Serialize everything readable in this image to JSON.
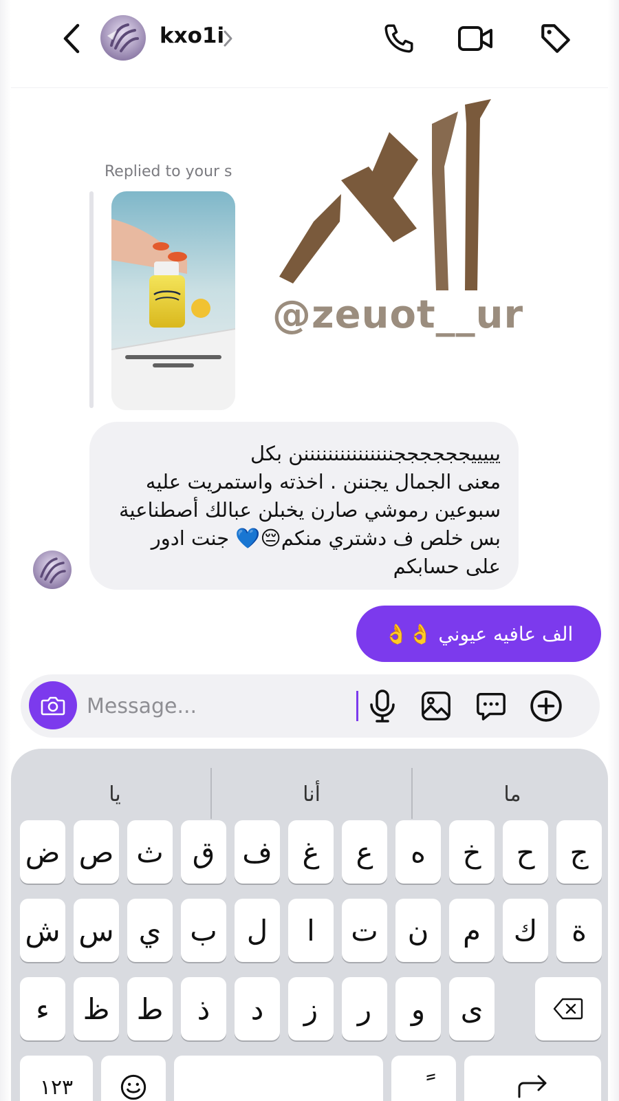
{
  "header": {
    "contact_name": "kxo1i",
    "back_icon": "chevron-left-icon",
    "call_icon": "phone-icon",
    "video_icon": "video-camera-icon",
    "tag_icon": "tag-icon"
  },
  "chat": {
    "story_reply": {
      "label": "Replied to your s",
      "watermark_handle": "@zeuot__ur"
    },
    "incoming_message": {
      "lines": [
        "يييييججججججنننننننننننننننن بكل",
        "معنى الجمال يجننن . اخذته واستمريت عليه",
        "سبوعين رموشي صارن يخبلن عبالك أصطناعية",
        "بس خلص ف دشتري منكم😔💙 جنت ادور",
        "على حسابكم"
      ]
    },
    "outgoing_message": {
      "text": "الف عافيه عيوني 👌👌"
    }
  },
  "composer": {
    "placeholder": "Message...",
    "value": "",
    "camera_icon": "camera-icon",
    "mic_icon": "microphone-icon",
    "gallery_icon": "image-icon",
    "sticker_icon": "chat-bubble-icon",
    "plus_icon": "plus-circle-icon"
  },
  "keyboard": {
    "suggestions": [
      "يا",
      "أنا",
      "ما"
    ],
    "row1": [
      "ض",
      "ص",
      "ث",
      "ق",
      "ف",
      "غ",
      "ع",
      "ه",
      "خ",
      "ح",
      "ج"
    ],
    "row2": [
      "ش",
      "س",
      "ي",
      "ب",
      "ل",
      "ا",
      "ت",
      "ن",
      "م",
      "ك",
      "ة"
    ],
    "row3": [
      "ء",
      "ظ",
      "ط",
      "ذ",
      "د",
      "ز",
      "ر",
      "و",
      "ى"
    ],
    "numbers_key": "١٢٣",
    "space_key": "",
    "diacritic_key": "ً",
    "emoji_icon": "emoji-icon",
    "delete_icon": "backspace-icon",
    "return_icon": "return-arrow-icon"
  },
  "colors": {
    "accent": "#7c3aed",
    "bubble_incoming": "#f1f1f4",
    "keyboard_bg": "#d9dbe0"
  }
}
